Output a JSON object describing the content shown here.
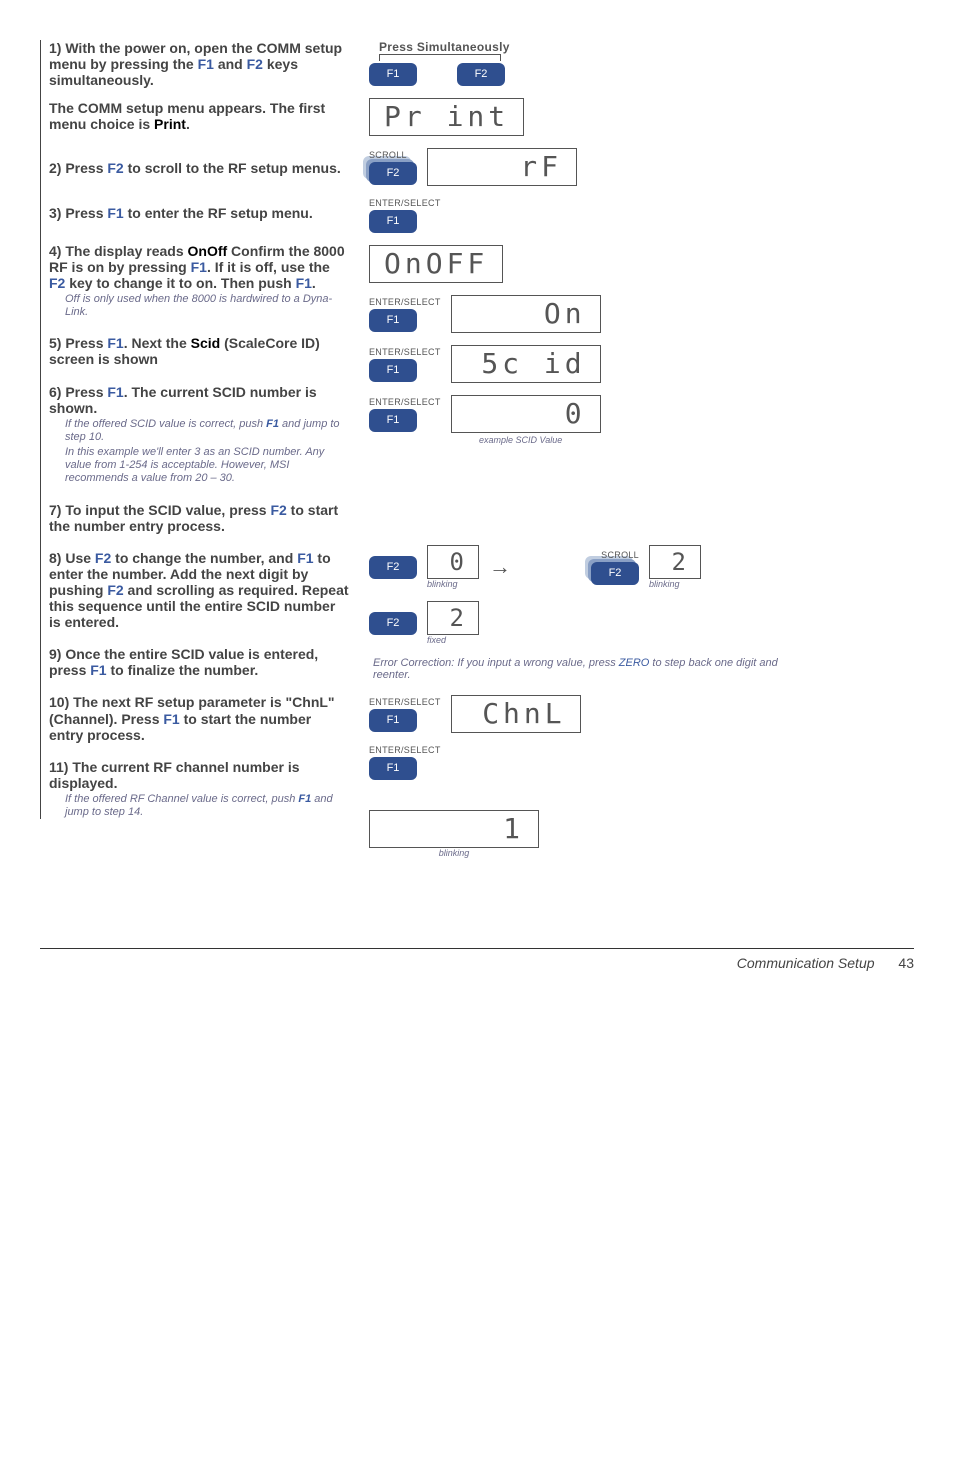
{
  "steps": {
    "s1": {
      "text_a": "1) With the power on, open the COMM setup menu by pressing the ",
      "f1": "F1",
      "mid1": " and ",
      "f2": "F2",
      "text_b": " keys simultaneously.",
      "para2_a": "The COMM setup menu appears. The first menu choice is ",
      "para2_kw": "Print",
      "para2_b": "."
    },
    "s2": {
      "a": "2) Press ",
      "f2": "F2",
      "b": " to scroll to the RF setup menus."
    },
    "s3": {
      "a": "3) Press ",
      "f1": "F1",
      "b": " to enter the RF setup menu."
    },
    "s4": {
      "a": "4) The display reads ",
      "kw": "OnOff",
      "b": " Confirm the 8000 RF is on by pressing ",
      "f1": "F1",
      "c": ". If it is off, use the ",
      "f2": "F2",
      "d": " key to change it to on. Then push ",
      "f1b": "F1",
      "e": ".",
      "note": "Off is only used when the 8000 is hardwired to a Dyna-Link."
    },
    "s5": {
      "a": "5) Press ",
      "f1": "F1",
      "b": ". Next the ",
      "kw": "Scid",
      "c": " (ScaleCore ID) screen is shown"
    },
    "s6": {
      "a": "6) Press ",
      "f1": "F1",
      "b": ". The current SCID number is shown.",
      "note1a": "If the offered SCID value is correct, push ",
      "note1_f1": "F1",
      "note1b": " and jump to step 10.",
      "note2": "In this example we'll enter 3 as an SCID number. Any value from 1-254 is acceptable. However, MSI recommends a value from 20 – 30."
    },
    "s7": {
      "a": "7) To input the SCID value, press ",
      "f2": "F2",
      "b": " to  start the number entry process."
    },
    "s8": {
      "a": "8) Use ",
      "f2": "F2",
      "b": " to change the number, and ",
      "f1": "F1",
      "c": " to enter the number. Add the next digit by pushing ",
      "f2b": "F2",
      "d": " and scrolling as required. Repeat this sequence until the entire SCID number is entered."
    },
    "s9": {
      "a": "9) Once the entire SCID value is entered, press ",
      "f1": "F1",
      "b": " to finalize the number."
    },
    "s10": {
      "a": "10) The next RF setup parameter is \"ChnL\" (Channel). Press ",
      "f1": "F1",
      "b": " to start the number entry process."
    },
    "s11": {
      "a": "11) The current RF channel number is displayed.",
      "note_a": "If the offered RF Channel value is correct, push ",
      "note_f1": "F1",
      "note_b": " and jump to step 14."
    }
  },
  "right": {
    "press_sim": "Press Simultaneously",
    "f1": "F1",
    "f2": "F2",
    "scroll": "SCROLL",
    "enter_select": "ENTER/SELECT",
    "disp_print": "Pr int",
    "disp_rf": "rF",
    "disp_onoff": "OnOFF",
    "disp_on": "On",
    "disp_scid": "5c id",
    "disp_zero": "0",
    "example_scid": "example SCID Value",
    "disp_small0": "0",
    "disp_small2": "2",
    "blinking": "blinking",
    "fixed": "fixed",
    "error_note_a": "Error Correction: If you input a wrong value, press ",
    "error_zero": "ZERO",
    "error_note_b": " to step back one digit and reenter.",
    "disp_chnl": "ChnL",
    "disp_one": "1"
  },
  "footer": {
    "section": "Communication Setup",
    "page": "43"
  }
}
